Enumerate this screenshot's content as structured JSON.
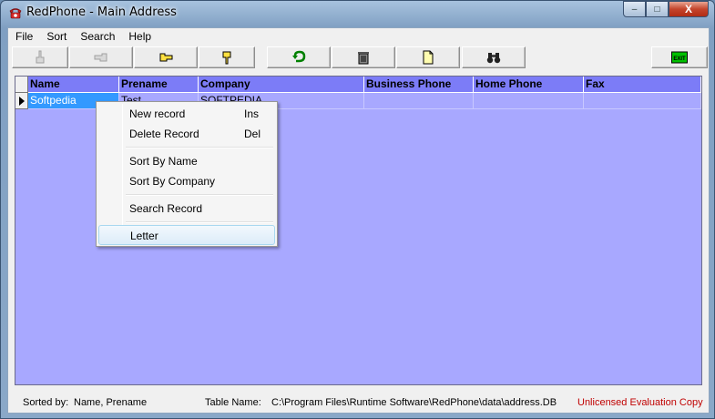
{
  "window": {
    "title": "RedPhone - Main Address",
    "min_label": "–",
    "max_label": "□",
    "close_label": "X"
  },
  "menu": [
    "File",
    "Sort",
    "Search",
    "Help"
  ],
  "toolbar": {
    "buttons": [
      {
        "icon": "hand-pointer-up-disabled-icon"
      },
      {
        "icon": "hand-pointer-left-disabled-icon"
      },
      {
        "icon": "hand-pointer-right-icon"
      },
      {
        "icon": "hand-pointer-down-icon"
      },
      {
        "icon": "undo-arrow-icon"
      },
      {
        "icon": "trash-can-icon"
      },
      {
        "icon": "new-document-icon"
      },
      {
        "icon": "binoculars-icon"
      },
      {
        "icon": "exit-icon",
        "label": "EXIT"
      }
    ]
  },
  "grid": {
    "columns": [
      "Name",
      "Prename",
      "Company",
      "Business Phone",
      "Home Phone",
      "Fax"
    ],
    "rows": [
      {
        "name": "Softpedia",
        "prename": "Test",
        "company": "SOFTPEDIA",
        "business_phone": "",
        "home_phone": "",
        "fax": ""
      }
    ],
    "background": "#a8a8ff",
    "header_color": "#7c7cf7"
  },
  "context_menu": {
    "items": [
      {
        "label": "New record",
        "shortcut": "Ins"
      },
      {
        "label": "Delete Record",
        "shortcut": "Del"
      },
      {
        "label": "Sort By Name",
        "shortcut": ""
      },
      {
        "label": "Sort By Company",
        "shortcut": ""
      },
      {
        "label": "Search Record",
        "shortcut": ""
      },
      {
        "label": "Letter",
        "shortcut": ""
      }
    ]
  },
  "status": {
    "sorted_by_label": "Sorted by:",
    "sorted_by_value": "Name, Prename",
    "table_name_label": "Table Name:",
    "table_name_value": "C:\\Program Files\\Runtime Software\\RedPhone\\data\\address.DB",
    "license": "Unlicensed Evaluation Copy"
  }
}
